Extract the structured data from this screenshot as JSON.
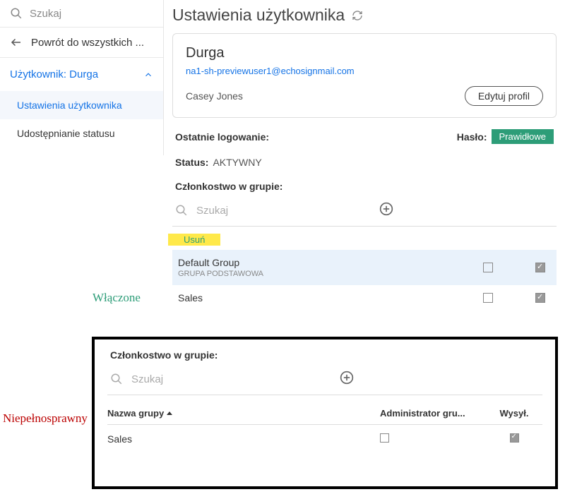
{
  "sidebar": {
    "search_placeholder": "Szukaj",
    "back_label": "Powrót do wszystkich ...",
    "user_label": "Użytkownik: Durga",
    "nav": {
      "settings": "Ustawienia użytkownika",
      "sharing": "Udostępnianie statusu"
    }
  },
  "page": {
    "title": "Ustawienia użytkownika"
  },
  "profile": {
    "name": "Durga",
    "email": "na1-sh-previewuser1@echosignmail.com",
    "full_name": "Casey Jones",
    "edit_label": "Edytuj profil"
  },
  "meta": {
    "last_login_label": "Ostatnie logowanie:",
    "password_label": "Hasło:",
    "password_value": "Prawidłowe",
    "status_label": "Status:",
    "status_value": "AKTYWNY"
  },
  "membership": {
    "title": "Członkostwo w grupie:",
    "search_placeholder": "Szukaj",
    "remove_label": "Usuń",
    "groups": [
      {
        "name": "Default Group",
        "sub": "GRUPA PODSTAWOWA",
        "admin": false,
        "send": true
      },
      {
        "name": "Sales",
        "sub": "",
        "admin": false,
        "send": true
      }
    ]
  },
  "annotations": {
    "enabled": "Włączone",
    "disabled": "Niepełnosprawny"
  },
  "framed": {
    "title": "Członkostwo w grupie:",
    "search_placeholder": "Szukaj",
    "columns": {
      "name": "Nazwa grupy",
      "admin": "Administrator gru...",
      "send": "Wysył."
    },
    "rows": [
      {
        "name": "Sales",
        "admin": false,
        "send": true
      }
    ]
  }
}
